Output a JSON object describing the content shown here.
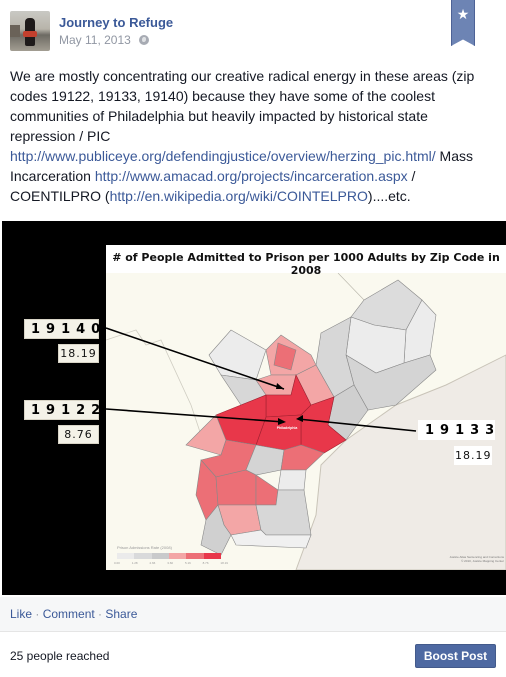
{
  "post": {
    "page_name": "Journey to Refuge",
    "date": "May 11, 2013",
    "audience_icon": "globe-icon",
    "bookmark_icon": "star-icon",
    "text_parts": {
      "intro": "We are mostly concentrating our creative radical energy in these areas (zip codes 19122, 19133, 19140) because they have some of the coolest communities of Philadelphia but heavily impacted by historical state repression / PIC ",
      "link1": "http://www.publiceye.org/defendingjustice/overview/herzing_pic.html/",
      "mid1": " Mass Incarceration ",
      "link2": "http://www.amacad.org/projects/incarceration.aspx",
      "mid2": " / COENTILPRO (",
      "link3": "http://en.wikipedia.org/wiki/COINTELPRO",
      "end": ")....etc."
    }
  },
  "image": {
    "title": "# of People Admitted to Prison per 1000 Adults by Zip Code in 2008",
    "city_label": "Philadelphia",
    "callouts": [
      {
        "zip": "19140",
        "rate": "18.19"
      },
      {
        "zip": "19122",
        "rate": "8.76"
      },
      {
        "zip": "19133",
        "rate": "18.19"
      }
    ],
    "legend": {
      "title": "Prison Admissions Rate (2008)",
      "colors": [
        "#ebebeb",
        "#d9dadb",
        "#c9cacb",
        "#f3a6a6",
        "#ec6f76",
        "#e8374a"
      ],
      "ticks": [
        "0.00",
        "1.28",
        "2.66",
        "3.60",
        "5.16",
        "8.76",
        "18.19"
      ]
    },
    "attribution": [
      "Justice Atlas Sentencing and Corrections",
      "© 2010, Justice Mapping Center"
    ]
  },
  "actions": {
    "like": "Like",
    "comment": "Comment",
    "share": "Share",
    "separator": " · "
  },
  "footer": {
    "reach": "25 people reached",
    "boost_label": "Boost Post"
  }
}
